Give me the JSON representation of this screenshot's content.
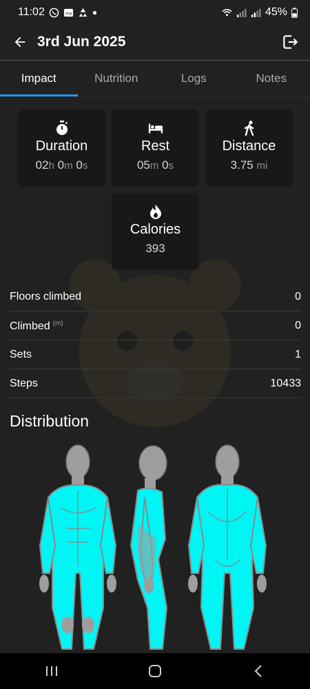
{
  "status_bar": {
    "time": "11:02",
    "battery": "45%",
    "left_icons": [
      "whatsapp-icon",
      "ring-icon",
      "recycle-icon",
      "dot-icon"
    ],
    "right_icons": [
      "wifi-icon",
      "signal-icon",
      "signal-icon-2",
      "battery-icon"
    ]
  },
  "header": {
    "title": "3rd Jun 2025",
    "back_icon": "back-arrow-icon",
    "export_icon": "export-icon"
  },
  "tabs": [
    {
      "label": "Impact",
      "active": true
    },
    {
      "label": "Nutrition",
      "active": false
    },
    {
      "label": "Logs",
      "active": false
    },
    {
      "label": "Notes",
      "active": false
    }
  ],
  "cards": {
    "duration": {
      "title": "Duration",
      "h": "02",
      "h_unit": "h",
      "m": " 0",
      "m_unit": "m",
      "s": " 0",
      "s_unit": "s",
      "icon": "stopwatch-icon"
    },
    "rest": {
      "title": "Rest",
      "m": "05",
      "m_unit": "m",
      "s": " 0",
      "s_unit": "s",
      "icon": "bed-icon"
    },
    "distance": {
      "title": "Distance",
      "value": "3.75",
      "unit": "mi",
      "icon": "walking-icon"
    },
    "calories": {
      "title": "Calories",
      "value": "393",
      "icon": "flame-icon"
    }
  },
  "stats": [
    {
      "label": "Floors climbed",
      "unit": "",
      "value": "0"
    },
    {
      "label": "Climbed",
      "unit": "(m)",
      "value": "0"
    },
    {
      "label": "Sets",
      "unit": "",
      "value": "1"
    },
    {
      "label": "Steps",
      "unit": "",
      "value": "10433"
    }
  ],
  "distribution": {
    "title": "Distribution",
    "highlight_color": "#00f5f5",
    "base_color": "#9e9e9e"
  },
  "nav": {
    "recents_icon": "recents-icon",
    "home_icon": "home-icon",
    "back_icon": "nav-back-icon"
  }
}
